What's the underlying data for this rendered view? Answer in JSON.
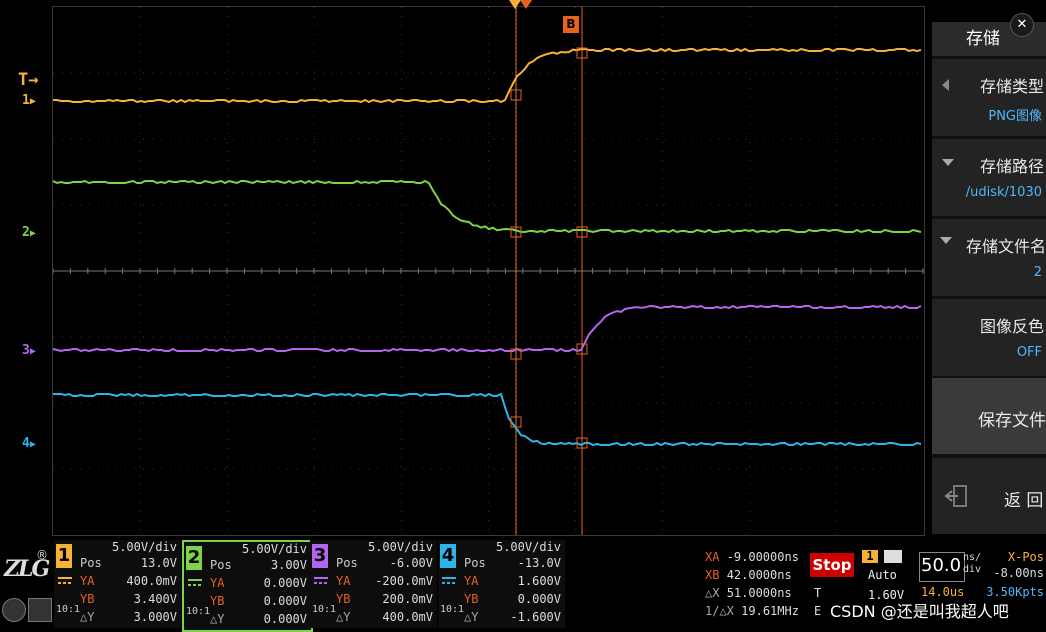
{
  "colors": {
    "ch1": "#f5b335",
    "ch2": "#7ed34a",
    "ch3": "#b466ef",
    "ch4": "#2fb4e9",
    "cursor": "#e8621e",
    "accent": "#4fb8ff"
  },
  "markers": {
    "trigger": "T",
    "ch1": "1",
    "ch2": "2",
    "ch3": "3",
    "ch4": "4",
    "cursorB": "B"
  },
  "menu": {
    "title": "存储",
    "close": "✕",
    "items": [
      {
        "label": "存储类型",
        "value": "PNG图像"
      },
      {
        "label": "存储路径",
        "value": "/udisk/1030"
      },
      {
        "label": "存储文件名",
        "value": "2"
      },
      {
        "label": "图像反色",
        "value": "OFF"
      }
    ],
    "save": "保存文件",
    "back": "返 回"
  },
  "brand": {
    "logo": "ZLG",
    "reg": "®"
  },
  "channels": [
    {
      "num": "1",
      "scale": "5.00V/div",
      "pos_label": "Pos",
      "pos": "13.0V",
      "ya_label": "YA",
      "ya": "400.0mV",
      "yb_label": "YB",
      "yb": "3.400V",
      "dy_label": "△Y",
      "dy": "3.000V",
      "ratio": "10:1"
    },
    {
      "num": "2",
      "scale": "5.00V/div",
      "pos_label": "Pos",
      "pos": "3.00V",
      "ya_label": "YA",
      "ya": "0.000V",
      "yb_label": "YB",
      "yb": "0.000V",
      "dy_label": "△Y",
      "dy": "0.000V",
      "ratio": "10:1"
    },
    {
      "num": "3",
      "scale": "5.00V/div",
      "pos_label": "Pos",
      "pos": "-6.00V",
      "ya_label": "YA",
      "ya": "-200.0mV",
      "yb_label": "YB",
      "yb": "200.0mV",
      "dy_label": "△Y",
      "dy": "400.0mV",
      "ratio": "10:1"
    },
    {
      "num": "4",
      "scale": "5.00V/div",
      "pos_label": "Pos",
      "pos": "-13.0V",
      "ya_label": "YA",
      "ya": "1.600V",
      "yb_label": "YB",
      "yb": "0.000V",
      "dy_label": "△Y",
      "dy": "-1.600V",
      "ratio": "10:1"
    }
  ],
  "measure": {
    "xa_label": "XA",
    "xa": "-9.00000ns",
    "xb_label": "XB",
    "xb": "42.0000ns",
    "dx_label": "△X",
    "dx": "51.0000ns",
    "inv_label": "1/△X",
    "inv": "19.61MHz"
  },
  "status": {
    "run": "Stop",
    "trig_ch": "1",
    "trig_mode": "Auto",
    "trig_label": "T",
    "trig_level": "1.60V",
    "trig_edge": "E"
  },
  "timebase": {
    "value": "50.0",
    "unit_top": "ns/",
    "unit_bot": "div",
    "xpos_label": "X-Pos",
    "xpos": "-8.00ns",
    "window": "14.0us",
    "points": "3.50Kpts"
  },
  "watermark": "CSDN @还是叫我超人吧"
}
